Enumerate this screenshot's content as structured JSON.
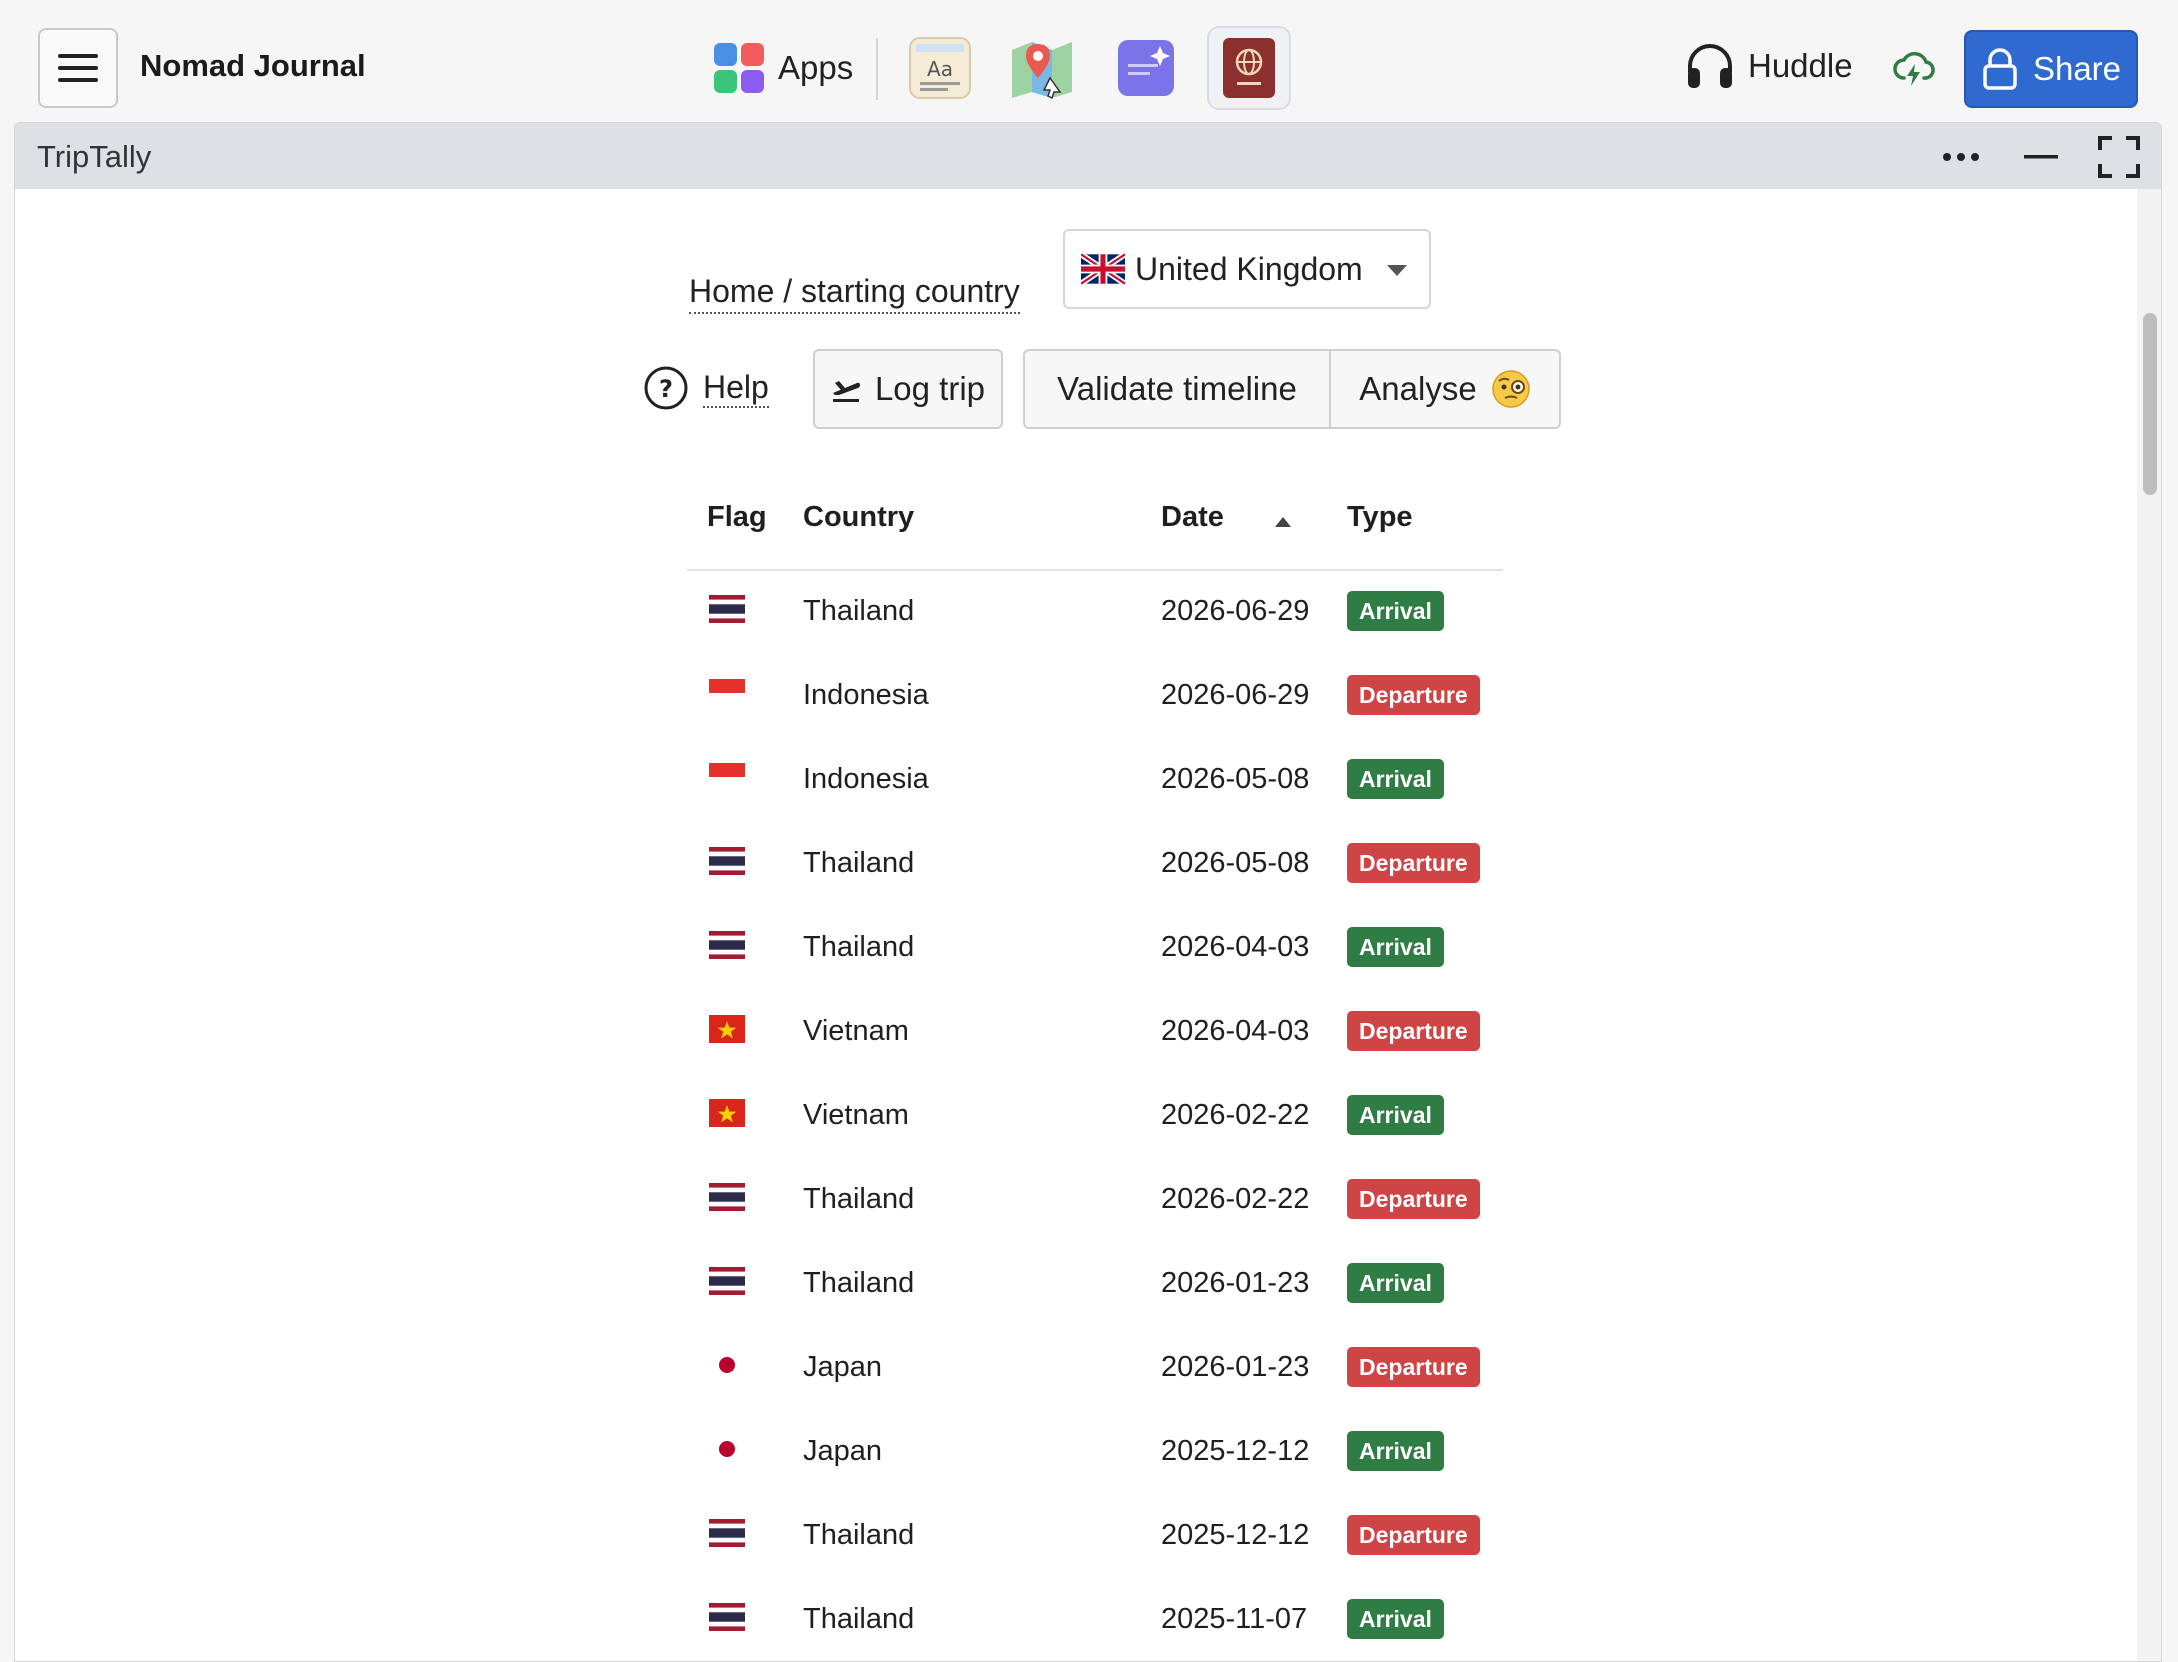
{
  "app": {
    "title": "Nomad Journal",
    "apps_label": "Apps",
    "huddle_label": "Huddle",
    "share_label": "Share",
    "launcher": [
      "dictionary-app-icon",
      "maps-app-icon",
      "notes-app-icon",
      "passport-app-icon"
    ]
  },
  "window": {
    "title": "TripTally"
  },
  "home": {
    "label": "Home / starting country",
    "selected_country": "United Kingdom"
  },
  "toolbar": {
    "help_label": "Help",
    "log_trip_label": "Log trip",
    "validate_label": "Validate timeline",
    "analyse_label": "Analyse"
  },
  "table": {
    "headers": {
      "flag": "Flag",
      "country": "Country",
      "date": "Date",
      "type": "Type"
    },
    "sort": {
      "column": "Date",
      "direction": "ascending"
    },
    "rows": [
      {
        "flag": "thailand",
        "country": "Thailand",
        "date": "2026-06-29",
        "type": "Arrival"
      },
      {
        "flag": "indonesia",
        "country": "Indonesia",
        "date": "2026-06-29",
        "type": "Departure"
      },
      {
        "flag": "indonesia",
        "country": "Indonesia",
        "date": "2026-05-08",
        "type": "Arrival"
      },
      {
        "flag": "thailand",
        "country": "Thailand",
        "date": "2026-05-08",
        "type": "Departure"
      },
      {
        "flag": "thailand",
        "country": "Thailand",
        "date": "2026-04-03",
        "type": "Arrival"
      },
      {
        "flag": "vietnam",
        "country": "Vietnam",
        "date": "2026-04-03",
        "type": "Departure"
      },
      {
        "flag": "vietnam",
        "country": "Vietnam",
        "date": "2026-02-22",
        "type": "Arrival"
      },
      {
        "flag": "thailand",
        "country": "Thailand",
        "date": "2026-02-22",
        "type": "Departure"
      },
      {
        "flag": "thailand",
        "country": "Thailand",
        "date": "2026-01-23",
        "type": "Arrival"
      },
      {
        "flag": "japan",
        "country": "Japan",
        "date": "2026-01-23",
        "type": "Departure"
      },
      {
        "flag": "japan",
        "country": "Japan",
        "date": "2025-12-12",
        "type": "Arrival"
      },
      {
        "flag": "thailand",
        "country": "Thailand",
        "date": "2025-12-12",
        "type": "Departure"
      },
      {
        "flag": "thailand",
        "country": "Thailand",
        "date": "2025-11-07",
        "type": "Arrival"
      }
    ]
  },
  "colors": {
    "accent": "#2f6ad1",
    "arrival": "#2f7d45",
    "departure": "#cf4444",
    "window_bar": "#dde1e5"
  }
}
